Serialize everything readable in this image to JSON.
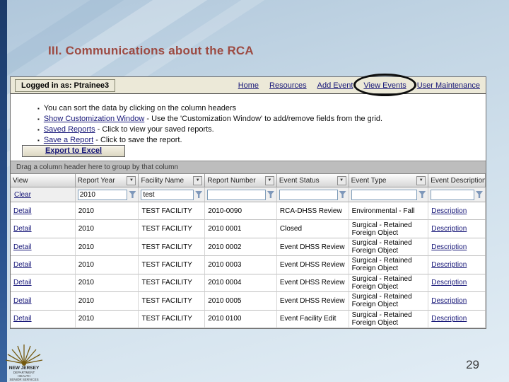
{
  "slide": {
    "title": "III.  Communications about the RCA",
    "page_number": "29",
    "logo_lines": [
      "NEW JERSEY",
      "DEPARTMENT",
      "HEALTH",
      "SENIOR SERVICES"
    ]
  },
  "app": {
    "topbar": {
      "logged_in": "Logged in as: Ptrainee3",
      "nav": [
        {
          "label": "Home",
          "circled": false
        },
        {
          "label": "Resources",
          "circled": false
        },
        {
          "label": "Add Event",
          "circled": false
        },
        {
          "label": "View Events",
          "circled": true
        },
        {
          "label": "User Maintenance",
          "circled": false
        }
      ]
    },
    "bullets": [
      {
        "link": "",
        "text": "You can sort the data by clicking on the column headers"
      },
      {
        "link": "Show Customization Window",
        "text": "-  Use the 'Customization Window' to add/remove fields from the grid."
      },
      {
        "link": "Saved Reports",
        "text": "- Click to view your saved reports."
      },
      {
        "link": "Save a Report",
        "text": "- Click to save the report."
      }
    ],
    "export_button": "Export to Excel",
    "group_bar": "Drag a column header here to group by that column",
    "grid": {
      "columns": [
        "View",
        "Report Year",
        "Facility Name",
        "Report Number",
        "Event Status",
        "Event Type",
        "Event Description"
      ],
      "filters": {
        "clear_label": "Clear",
        "values": [
          "",
          "2010",
          "test",
          "",
          "",
          "",
          ""
        ]
      },
      "rows": [
        {
          "view": "Detail",
          "report_year": "2010",
          "facility_name": "TEST FACILITY",
          "report_number": "2010-0090",
          "event_status": "RCA-DHSS Review",
          "event_type": "Environmental - Fall",
          "event_description": "Description"
        },
        {
          "view": "Detail",
          "report_year": "2010",
          "facility_name": "TEST FACILITY",
          "report_number": "2010 0001",
          "event_status": "Closed",
          "event_type": "Surgical - Retained Foreign Object",
          "event_description": "Description"
        },
        {
          "view": "Detail",
          "report_year": "2010",
          "facility_name": "TEST FACILITY",
          "report_number": "2010 0002",
          "event_status": "Event DHSS Review",
          "event_type": "Surgical - Retained Foreign Object",
          "event_description": "Description"
        },
        {
          "view": "Detail",
          "report_year": "2010",
          "facility_name": "TEST FACILITY",
          "report_number": "2010 0003",
          "event_status": "Event DHSS Review",
          "event_type": "Surgical - Retained Foreign Object",
          "event_description": "Description"
        },
        {
          "view": "Detail",
          "report_year": "2010",
          "facility_name": "TEST FACILITY",
          "report_number": "2010 0004",
          "event_status": "Event DHSS Review",
          "event_type": "Surgical - Retained Foreign Object",
          "event_description": "Description"
        },
        {
          "view": "Detail",
          "report_year": "2010",
          "facility_name": "TEST FACILITY",
          "report_number": "2010 0005",
          "event_status": "Event DHSS Review",
          "event_type": "Surgical - Retained Foreign Object",
          "event_description": "Description"
        },
        {
          "view": "Detail",
          "report_year": "2010",
          "facility_name": "TEST FACILITY",
          "report_number": "2010 0100",
          "event_status": "Event Facility Edit",
          "event_type": "Surgical - Retained Foreign Object",
          "event_description": "Description"
        }
      ]
    }
  },
  "colors": {
    "title": "#9c4a42",
    "link_navy": "#161678",
    "sidebar_navy": "#1b3a68"
  }
}
